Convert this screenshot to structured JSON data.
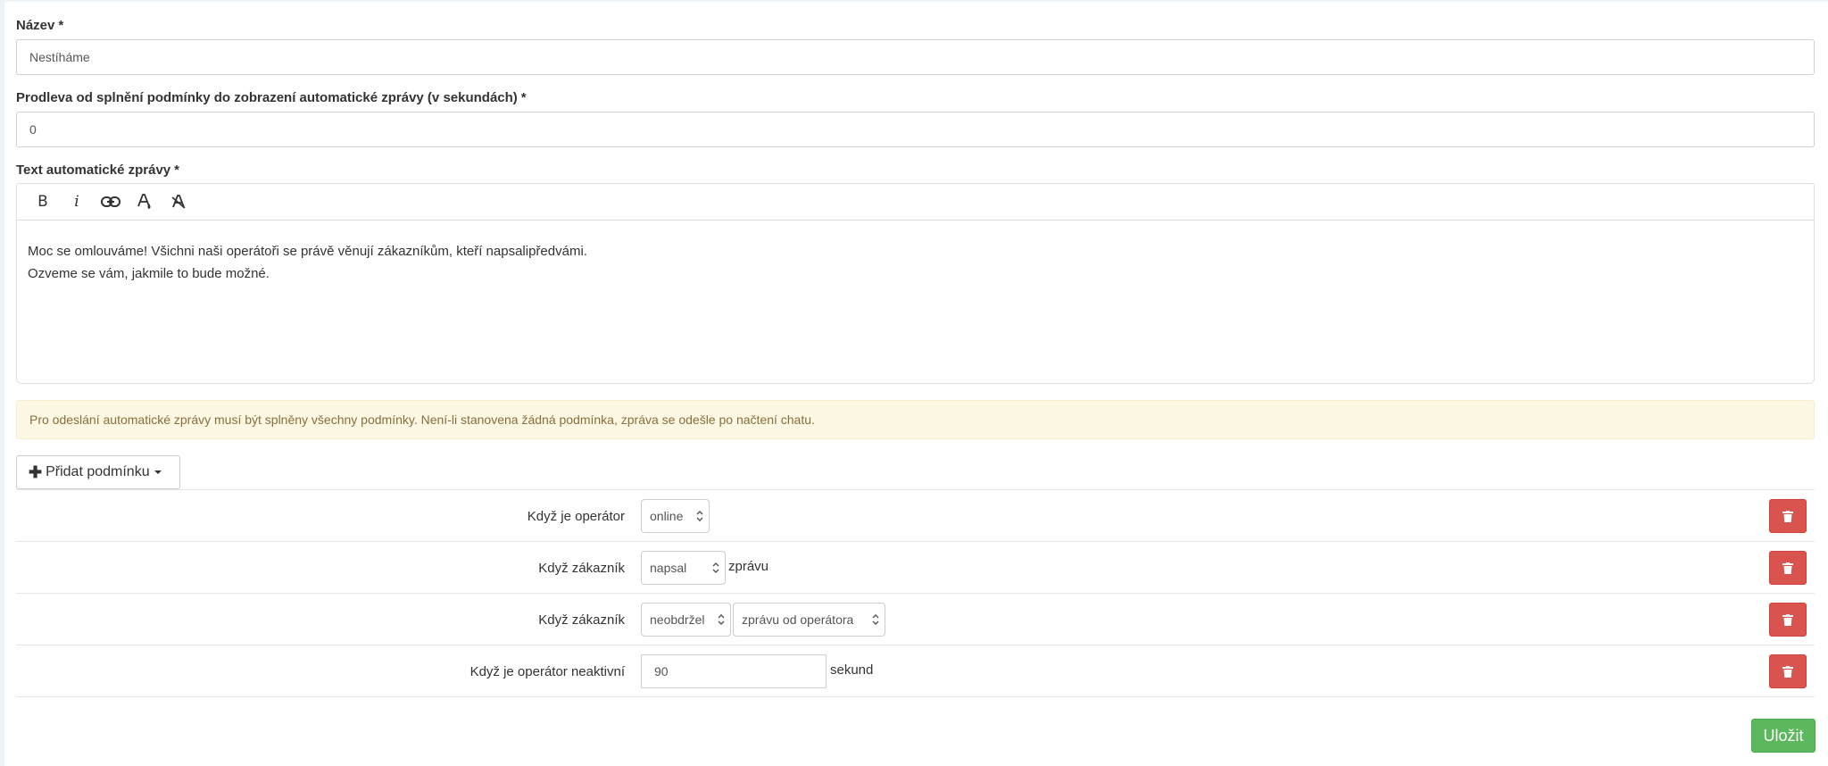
{
  "form": {
    "name_label": "Název",
    "name_value": "Nestíháme",
    "delay_label": "Prodleva od splnění podmínky do zobrazení automatické zprávy (v sekundách)",
    "delay_value": "0",
    "text_label": "Text automatické zprávy",
    "required_mark": "*"
  },
  "editor": {
    "tools": [
      "bold-icon",
      "italic-icon",
      "link-icon",
      "text-color-icon",
      "clear-format-icon"
    ],
    "tool_labels": [
      "B",
      "i"
    ],
    "line1": "Moc se omlouváme! Všichni naši operátoři se právě věnují zákazníkům, kteří napsalipředvámi.",
    "line2": "Ozveme se vám, jakmile to bude možné."
  },
  "alert": {
    "text": "Pro odeslání automatické zprávy musí být splněny všechny podmínky. Není-li stanovena žádná podmínka, zpráva se odešle po načtení chatu."
  },
  "add_condition": {
    "label": "Přidat podmínku"
  },
  "conditions": [
    {
      "label": "Když je operátor",
      "select": "online"
    },
    {
      "label": "Když zákazník",
      "select": "napsal",
      "suffix": "zprávu"
    },
    {
      "label": "Když zákazník",
      "select": "neobdržel",
      "select2": "zprávu od operátora"
    },
    {
      "label": "Když je operátor neaktivní",
      "value": "90",
      "suffix": "sekund"
    }
  ],
  "save": {
    "label": "Uložit"
  },
  "colors": {
    "danger": "#d9534f",
    "success": "#5cb85c",
    "warning_bg": "#fcf8e3",
    "warning_text": "#8a6d3b"
  }
}
